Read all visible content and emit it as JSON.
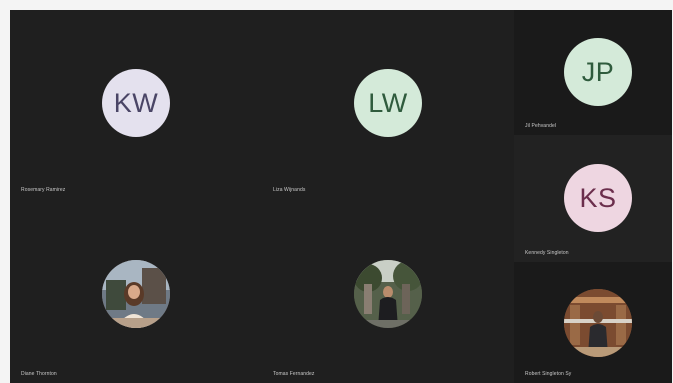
{
  "colors": {
    "background": "#1c1c1c",
    "tile": "#1f1f1f",
    "tile_alt": "#222222",
    "name_text": "#c9c9c9"
  },
  "participants": [
    {
      "initials": "KW",
      "name": "Rosemary Ramirez",
      "avatar_bg": "#e4e1ee",
      "avatar_fg": "#4a4566",
      "has_photo": false
    },
    {
      "initials": "LW",
      "name": "Liza Wijnands",
      "avatar_bg": "#d4ead9",
      "avatar_fg": "#2f5b3d",
      "has_photo": false
    },
    {
      "initials": "JP",
      "name": "Jil Pehvandel",
      "avatar_bg": "#d4ead9",
      "avatar_fg": "#2f5b3d",
      "has_photo": false
    },
    {
      "initials": "KS",
      "name": "Kennedy Singleton",
      "avatar_bg": "#eed6e1",
      "avatar_fg": "#6b2e4c",
      "has_photo": false
    },
    {
      "initials": "",
      "name": "Diane Thornton",
      "avatar_bg": "#8a6e5a",
      "avatar_fg": "",
      "has_photo": true
    },
    {
      "initials": "",
      "name": "Tomas Fernandez",
      "avatar_bg": "#4d5a42",
      "avatar_fg": "",
      "has_photo": true
    },
    {
      "initials": "",
      "name": "Robert Singleton Sy",
      "avatar_bg": "#8b5a3a",
      "avatar_fg": "",
      "has_photo": true
    }
  ]
}
